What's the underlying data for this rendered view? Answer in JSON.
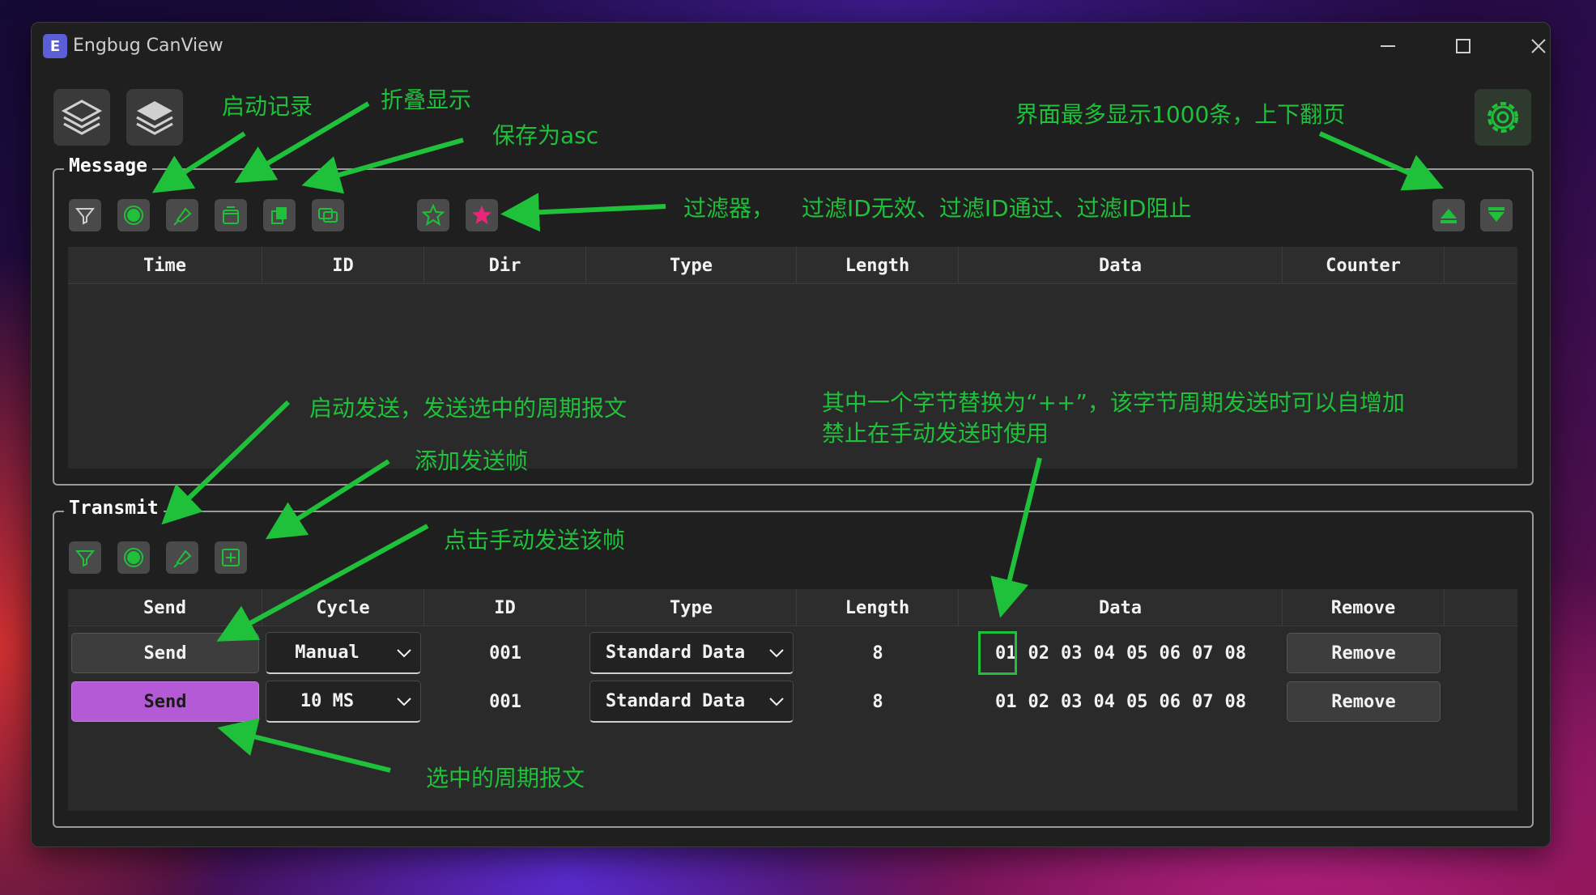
{
  "window": {
    "title": "Engbug CanView",
    "app_icon_letter": "E"
  },
  "message": {
    "group_title": "Message",
    "columns": [
      "Time",
      "ID",
      "Dir",
      "Type",
      "Length",
      "Data",
      "Counter"
    ],
    "rows": []
  },
  "transmit": {
    "group_title": "Transmit",
    "columns": [
      "Send",
      "ID",
      "Type",
      "Length",
      "Data",
      "Remove"
    ],
    "cycle_column": "Cycle",
    "rows": [
      {
        "send": "Send",
        "cycle": "Manual",
        "id": "001",
        "type": "Standard Data",
        "length": "8",
        "data": [
          "01",
          "02",
          "03",
          "04",
          "05",
          "06",
          "07",
          "08"
        ],
        "remove": "Remove",
        "selected": false
      },
      {
        "send": "Send",
        "cycle": "10 MS",
        "id": "001",
        "type": "Standard Data",
        "length": "8",
        "data": [
          "01",
          "02",
          "03",
          "04",
          "05",
          "06",
          "07",
          "08"
        ],
        "remove": "Remove",
        "selected": true
      }
    ]
  },
  "annotations": {
    "start_record": "启动记录",
    "fold_display": "折叠显示",
    "save_asc": "保存为asc",
    "page_limit": "界面最多显示1000条，上下翻页",
    "filter": "过滤器，",
    "filter_modes": "过滤ID无效、过滤ID通过、过滤ID阻止",
    "start_send": "启动发送，发送选中的周期报文",
    "add_frame": "添加发送帧",
    "manual_send": "点击手动发送该帧",
    "byte_increment_1": "其中一个字节替换为“++”，该字节周期发送时可以自增加",
    "byte_increment_2": "禁止在手动发送时使用",
    "selected_periodic": "选中的周期报文"
  },
  "colors": {
    "accent_green": "#1fc03a",
    "selected_send": "#b45ad6",
    "star_pink": "#e8277a"
  }
}
